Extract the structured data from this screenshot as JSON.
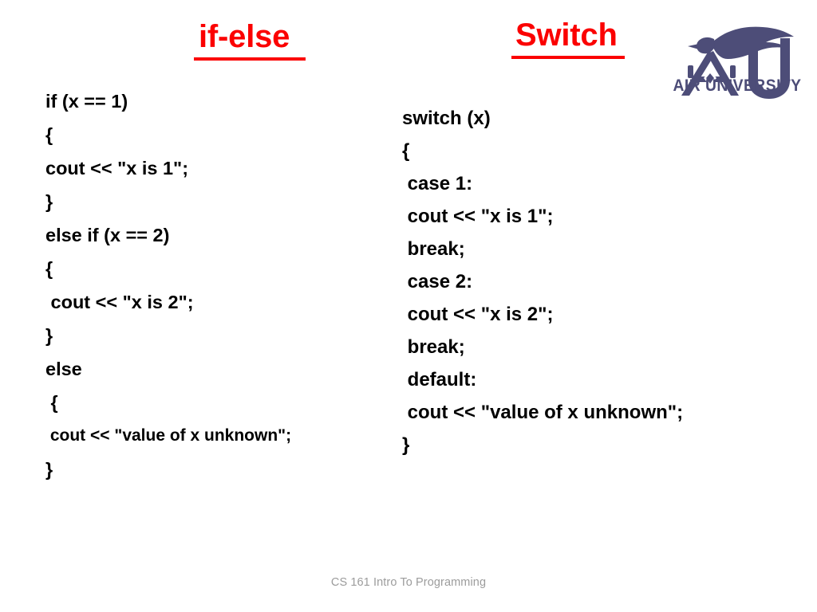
{
  "slide": {
    "background_color": "#ffffff",
    "footer": "CS 161 Intro To Programming"
  },
  "headings": {
    "left": "if-else",
    "right": "Switch",
    "color": "#fb0000"
  },
  "logo": {
    "name": "air-university-logo",
    "wordmark": "AIR UNIVERSITY",
    "color": "#4d4d78"
  },
  "code_ifelse": {
    "title": "if-else",
    "language": "cpp",
    "lines": [
      "if (x == 1)",
      "{",
      "cout << \"x is 1\";",
      "}",
      "else if (x == 2)",
      "{",
      " cout << \"x is 2\";",
      "}",
      "else",
      " {",
      " cout << \"value of x unknown\";",
      "}"
    ]
  },
  "code_switch": {
    "title": "Switch",
    "language": "cpp",
    "lines": [
      "switch (x)",
      "{",
      " case 1:",
      " cout << \"x is 1\";",
      " break;",
      " case 2:",
      " cout << \"x is 2\";",
      " break;",
      " default:",
      " cout << \"value of x unknown\";",
      "}"
    ]
  }
}
